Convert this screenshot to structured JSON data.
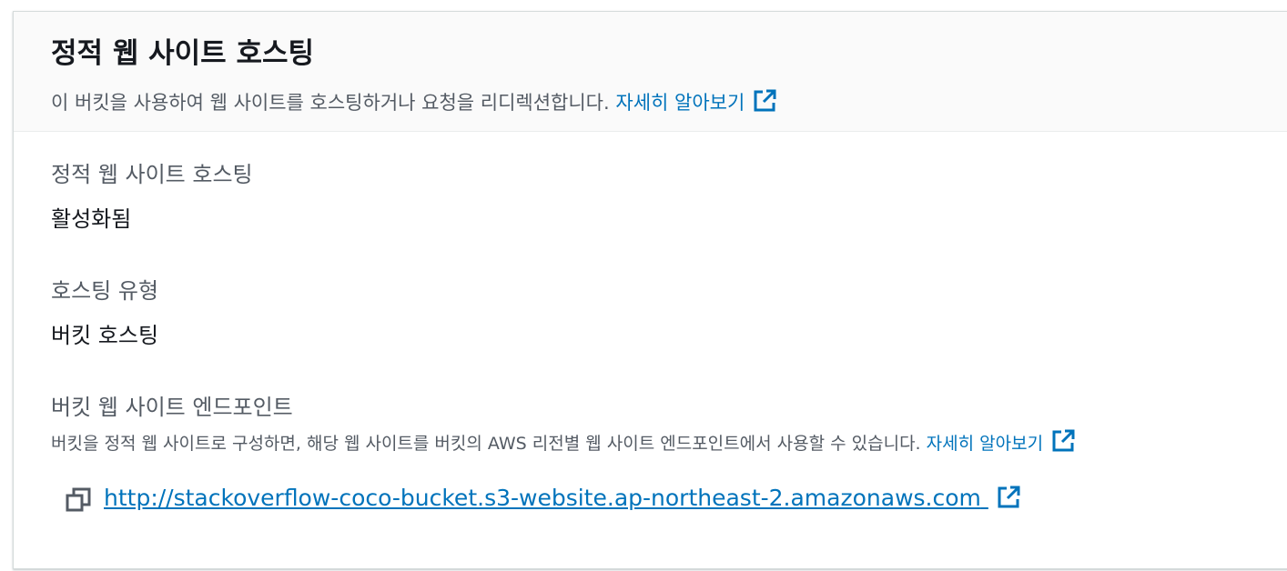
{
  "header": {
    "title": "정적 웹 사이트 호스팅",
    "description": "이 버킷을 사용하여 웹 사이트를 호스팅하거나 요청을 리디렉션합니다.",
    "learn_more": "자세히 알아보기",
    "learn_more_icon": "external-link-icon"
  },
  "fields": {
    "hosting": {
      "label": "정적 웹 사이트 호스팅",
      "value": "활성화됨"
    },
    "hosting_type": {
      "label": "호스팅 유형",
      "value": "버킷 호스팅"
    },
    "endpoint": {
      "label": "버킷 웹 사이트 엔드포인트",
      "description": "버킷을 정적 웹 사이트로 구성하면, 해당 웹 사이트를 버킷의 AWS 리전별 웹 사이트 엔드포인트에서 사용할 수 있습니다.",
      "learn_more": "자세히 알아보기",
      "url": "http://stackoverflow-coco-bucket.s3-website.ap-northeast-2.amazonaws.com",
      "copy_icon": "copy-icon",
      "url_icon": "external-link-icon"
    }
  },
  "colors": {
    "link": "#0073bb",
    "text_primary": "#16191f",
    "text_secondary": "#545b64",
    "header_bg": "#fafafa"
  }
}
